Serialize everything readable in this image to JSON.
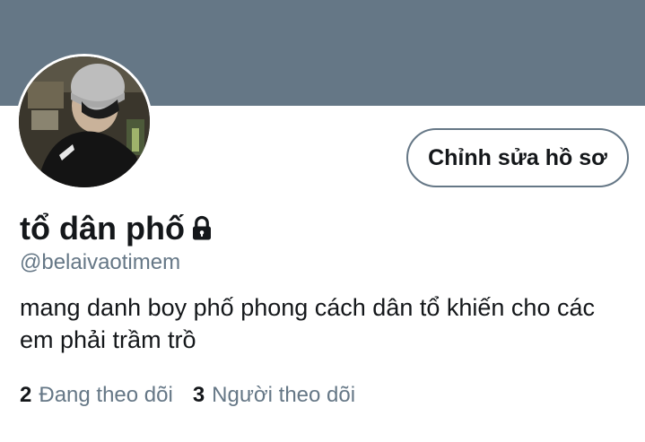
{
  "profile": {
    "display_name": "tổ dân phố",
    "handle": "@belaivaotimem",
    "bio": "mang danh boy phố phong cách dân tổ khiến cho các em phải trầm trồ",
    "protected_icon": "lock-icon",
    "edit_button_label": "Chỉnh sửa hồ sơ"
  },
  "stats": {
    "following_count": "2",
    "following_label": "Đang theo dõi",
    "followers_count": "3",
    "followers_label": "Người theo dõi"
  },
  "colors": {
    "banner": "#657786",
    "primary_text": "#14171a",
    "secondary_text": "#657786",
    "button_border": "#657786"
  }
}
